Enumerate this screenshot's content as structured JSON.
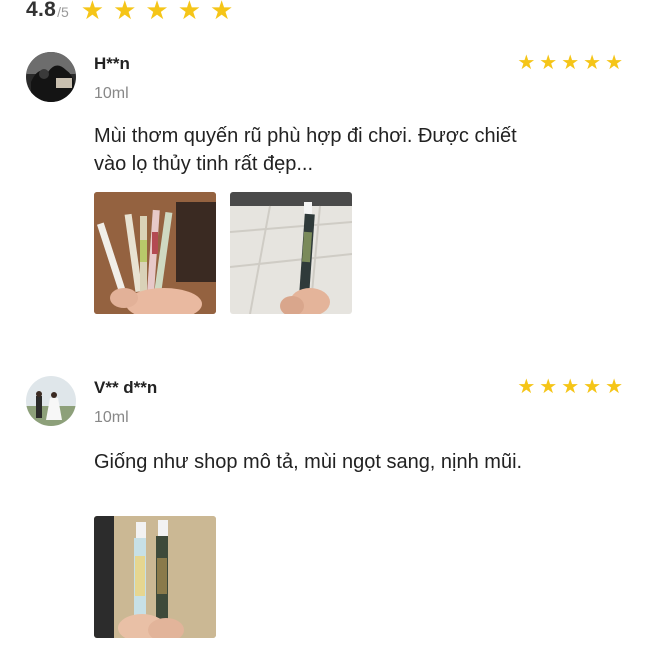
{
  "summary": {
    "rating": "4.8",
    "rating_max": "/5",
    "stars": 5
  },
  "reviews": [
    {
      "name": "H**n",
      "variant": "10ml",
      "stars": 5,
      "text_line1": "Mùi thơm quyến rũ  phù hợp đi chơi. Được chiết",
      "text_line2": "vào lọ thủy tinh rất đẹp..."
    },
    {
      "name": "V** d**n",
      "variant": "10ml",
      "stars": 5,
      "text_line1": "Giống như shop mô tả, mùi ngọt sang, nịnh mũi."
    }
  ],
  "colors": {
    "star": "#f5c518",
    "variant_text": "#888888",
    "body_text": "#222222"
  },
  "icons": {
    "star": "star-icon"
  }
}
